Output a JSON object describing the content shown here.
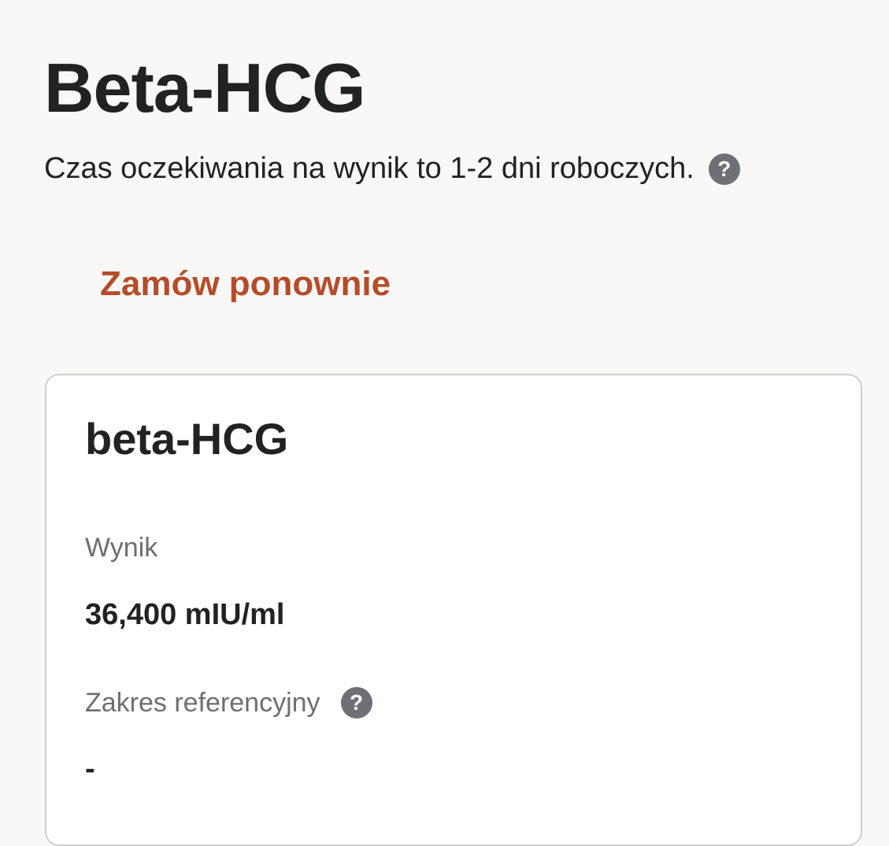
{
  "header": {
    "title": "Beta-HCG",
    "wait_text": "Czas oczekiwania na wynik to 1-2 dni roboczych.",
    "help_icon": "question-mark-circle"
  },
  "actions": {
    "reorder_label": "Zamów ponownie",
    "reorder_color": "#b54c2a"
  },
  "result": {
    "test_name": "beta-HCG",
    "result_label": "Wynik",
    "result_value": "36,400 mIU/ml",
    "reference_label": "Zakres referencyjny",
    "reference_help_icon": "question-mark-circle",
    "reference_value": "-"
  }
}
